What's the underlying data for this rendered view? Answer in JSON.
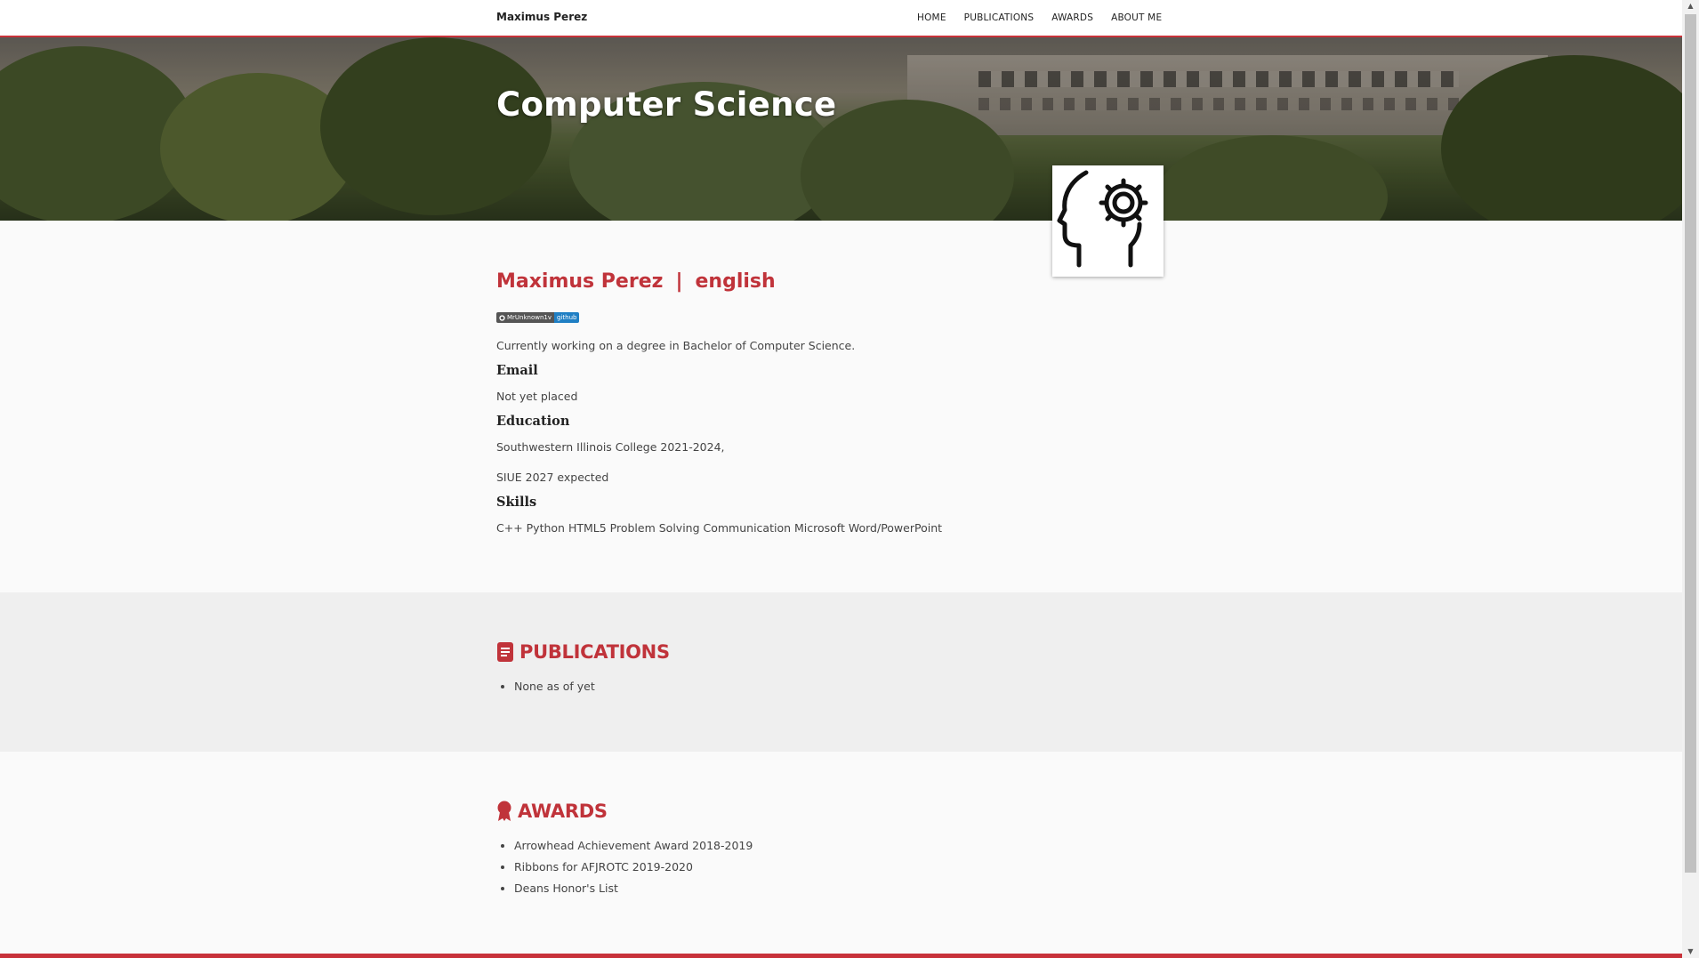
{
  "navbar": {
    "brand": "Maximus Perez",
    "links": [
      "HOME",
      "PUBLICATIONS",
      "AWARDS",
      "ABOUT ME"
    ]
  },
  "hero": {
    "title": "Computer Science"
  },
  "profile": {
    "name": "Maximus Perez",
    "separator": "|",
    "language": "english"
  },
  "badge": {
    "left": "MrUnknown1v",
    "right": "github"
  },
  "about": {
    "summary": "Currently working on a degree in Bachelor of Computer Science.",
    "email_heading": "Email",
    "email_value": "Not yet placed",
    "education_heading": "Education",
    "education_line1": "Southwestern Illinois College 2021-2024,",
    "education_line2": "SIUE 2027 expected",
    "skills_heading": "Skills",
    "skills_value": "C++ Python HTML5 Problem Solving Communication Microsoft Word/PowerPoint"
  },
  "publications": {
    "title": "PUBLICATIONS",
    "items": [
      "None as of yet"
    ]
  },
  "awards": {
    "title": "AWARDS",
    "items": [
      "Arrowhead Achievement Award 2018-2019",
      "Ribbons for AFJROTC 2019-2020",
      "Deans Honor's List"
    ]
  },
  "colors": {
    "accent": "#c0333a",
    "nav_border": "#c8323a",
    "badge_right": "#1f7fc4"
  },
  "icons": {
    "profile": "head-gear-icon",
    "publications": "document-icon",
    "awards": "award-ribbon-icon"
  }
}
